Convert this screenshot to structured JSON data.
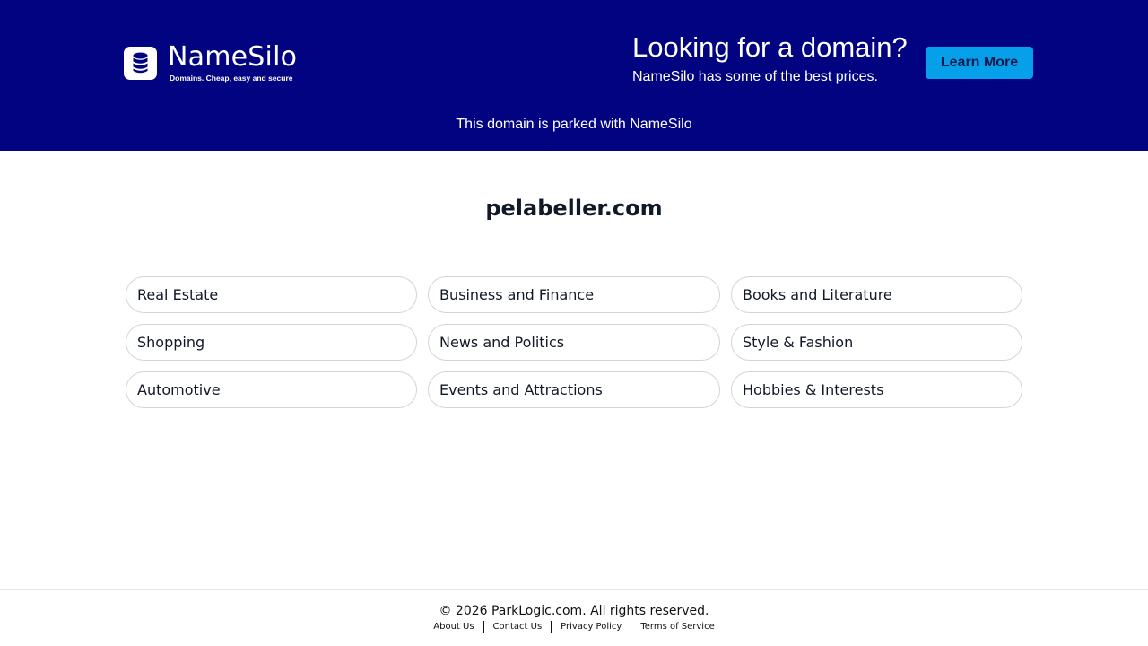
{
  "header": {
    "logo": {
      "name": "NameSilo",
      "tagline": "Domains. Cheap, easy and secure",
      "icon": "database-icon"
    },
    "promo": {
      "heading": "Looking for a domain?",
      "subheading": "NameSilo has some of the best prices."
    },
    "cta_label": "Learn More",
    "parked_notice": "This domain is parked with NameSilo"
  },
  "main": {
    "domain": "pelabeller.com",
    "categories": [
      "Real Estate",
      "Business and Finance",
      "Books and Literature",
      "Shopping",
      "News and Politics",
      "Style & Fashion",
      "Automotive",
      "Events and Attractions",
      "Hobbies & Interests"
    ]
  },
  "footer": {
    "copyright": "© 2026 ParkLogic.com. All rights reserved.",
    "links": [
      "About Us",
      "Contact Us",
      "Privacy Policy",
      "Terms of Service"
    ]
  },
  "colors": {
    "banner_background": "#020381",
    "cta_background": "#06a0ea",
    "cta_text": "#111a4e",
    "pill_border": "#d1d5db"
  }
}
